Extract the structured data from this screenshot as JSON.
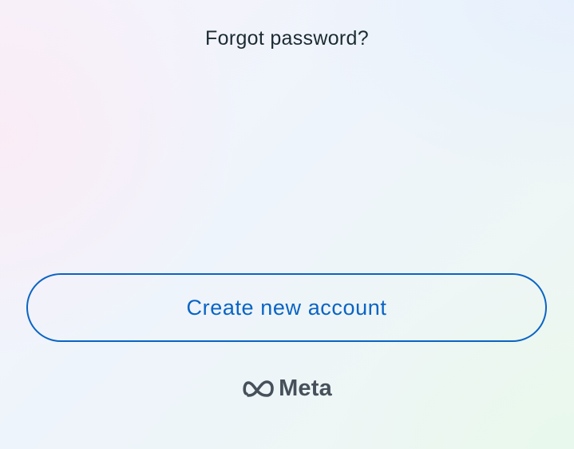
{
  "login": {
    "forgot_password_label": "Forgot password?",
    "create_account_label": "Create new account"
  },
  "footer": {
    "brand_name": "Meta",
    "brand_icon": "meta-infinity-icon"
  },
  "colors": {
    "accent": "#0a64c4",
    "text_primary": "#1c2b33",
    "brand_gray": "#45505a"
  }
}
